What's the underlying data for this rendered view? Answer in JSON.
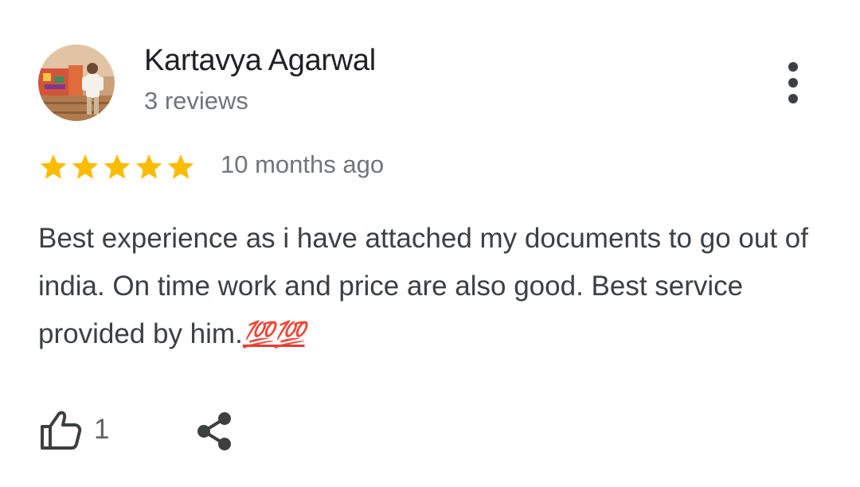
{
  "review": {
    "author": {
      "name": "Kartavya Agarwal",
      "review_count": "3 reviews",
      "avatar_icon": "profile-photo"
    },
    "rating": {
      "stars": 5,
      "max_stars": 5,
      "star_color": "#fbbc04"
    },
    "time_ago": "10 months ago",
    "text": "Best experience as i have attached my documents to go out of india. On time work and price are also good. Best service provided by him.",
    "emoji": "💯💯",
    "actions": {
      "like_icon": "thumbs-up-icon",
      "like_count": "1",
      "share_icon": "share-icon",
      "menu_icon": "more-vert-icon"
    }
  }
}
